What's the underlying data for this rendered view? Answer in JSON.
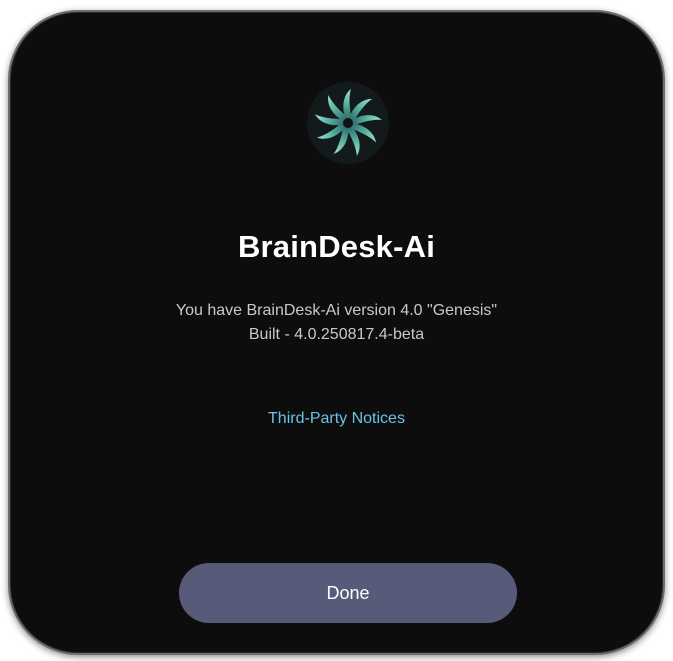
{
  "app": {
    "name": "BrainDesk-Ai",
    "logo_icon": "braindesk-ai-logo-icon"
  },
  "about": {
    "version_text": "You have BrainDesk-Ai version 4.0 \"Genesis\"",
    "build_text": "Built - 4.0.250817.4-beta",
    "third_party_link": "Third-Party Notices"
  },
  "actions": {
    "done_label": "Done"
  },
  "colors": {
    "background": "#0d0d0e",
    "link": "#69c3e6",
    "button": "#575a79",
    "logo_teal": "#4fb3a6"
  }
}
